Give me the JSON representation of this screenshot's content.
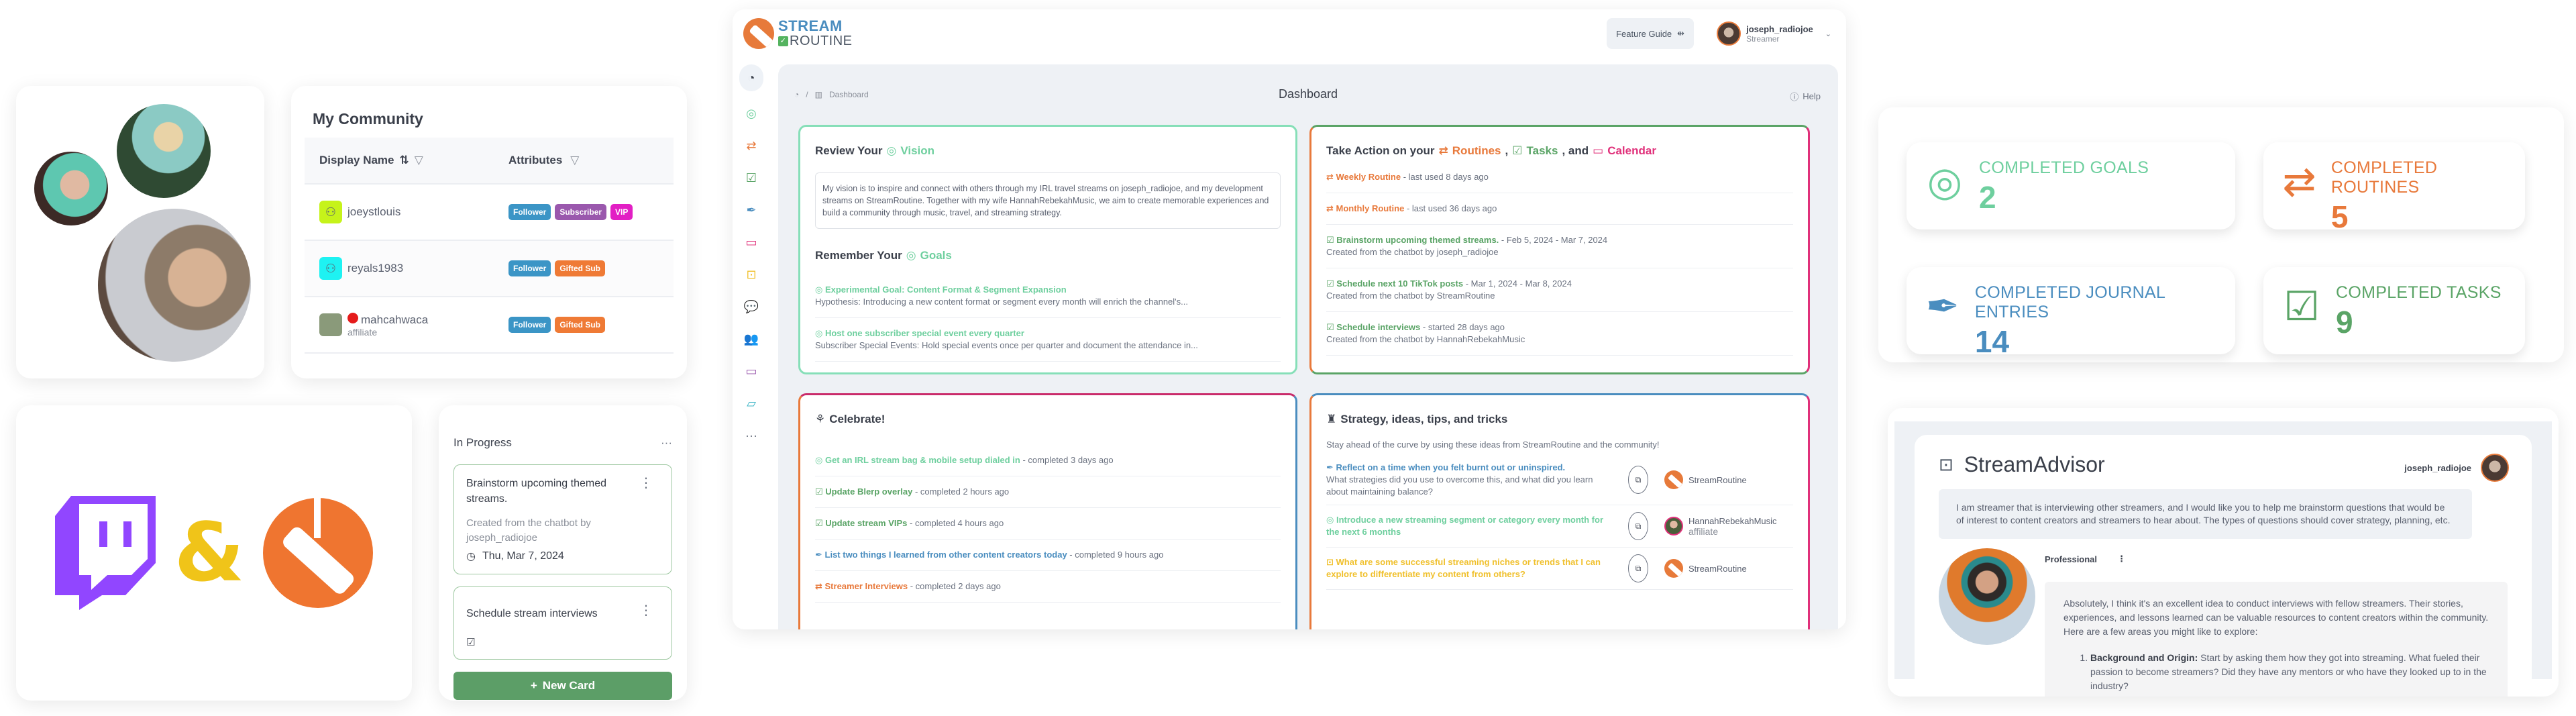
{
  "community": {
    "title": "My Community",
    "columns": [
      "Display Name",
      "Attributes"
    ],
    "rows": [
      {
        "name": "joeystlouis",
        "sub": "",
        "avatar_color": "#c6f31a",
        "badges": [
          {
            "label": "Follower",
            "color": "#3b95c6"
          },
          {
            "label": "Subscriber",
            "color": "#9a58ad"
          },
          {
            "label": "VIP",
            "color": "#e21fc4"
          }
        ]
      },
      {
        "name": "reyals1983",
        "sub": "",
        "avatar_color": "#1ef2f2",
        "badges": [
          {
            "label": "Follower",
            "color": "#3b95c6"
          },
          {
            "label": "Gifted Sub",
            "color": "#ef7a35"
          }
        ]
      },
      {
        "name": "mahcahwaca",
        "sub": "affiliate",
        "avatar_color": "#8a9a7a",
        "badges": [
          {
            "label": "Follower",
            "color": "#3b95c6"
          },
          {
            "label": "Gifted Sub",
            "color": "#ef7a35"
          }
        ]
      }
    ]
  },
  "logos": {
    "amp": "&"
  },
  "kanban": {
    "column_title": "In Progress",
    "cards": [
      {
        "title": "Brainstorm upcoming themed streams.",
        "desc": "Created from the chatbot by joseph_radiojoe",
        "date": "Thu, Mar 7, 2024"
      },
      {
        "title": "Schedule stream interviews",
        "desc": "",
        "date": ""
      }
    ],
    "new_card_label": "New Card"
  },
  "app": {
    "logo_line1": "STREAM",
    "logo_line2": "ROUTINE",
    "feature_guide": "Feature Guide",
    "user": {
      "name": "joseph_radiojoe",
      "role": "Streamer"
    },
    "breadcrumb": "Dashboard",
    "page_title": "Dashboard",
    "help": "Help",
    "sidebar_icons": [
      "dashboard-icon",
      "goals-icon",
      "routines-icon",
      "tasks-icon",
      "journal-icon",
      "calendar-icon",
      "advisor-icon",
      "qa-icon",
      "community-icon",
      "video-icon",
      "folder-icon",
      "more-icon"
    ]
  },
  "vision": {
    "review_prefix": "Review Your",
    "review_word": "Vision",
    "text": "My vision is to inspire and connect with others through my IRL travel streams on joseph_radiojoe, and my development streams on StreamRoutine. Together with my wife HannahRebekahMusic, we aim to create memorable experiences and build a community through music, travel, and streaming strategy.",
    "goals_prefix": "Remember Your",
    "goals_word": "Goals",
    "goals": [
      {
        "title": "Experimental Goal: Content Format & Segment Expansion",
        "desc": "Hypothesis: Introducing a new content format or segment every month will enrich the channel's..."
      },
      {
        "title": "Host one subscriber special event every quarter",
        "desc": "Subscriber Special Events: Hold special events once per quarter and document the attendance in..."
      }
    ]
  },
  "action": {
    "prefix": "Take Action on your",
    "routines": "Routines",
    "tasks": "Tasks",
    "and": ", and",
    "calendar": "Calendar",
    "items": [
      {
        "kind": "routine",
        "title": "Weekly Routine",
        "meta": " - last used 8 days ago",
        "sub": ""
      },
      {
        "kind": "routine",
        "title": "Monthly Routine",
        "meta": " - last used 36 days ago",
        "sub": ""
      },
      {
        "kind": "task",
        "title": "Brainstorm upcoming themed streams.",
        "meta": " - Feb 5, 2024 - Mar 7, 2024",
        "sub": "Created from the chatbot by joseph_radiojoe"
      },
      {
        "kind": "task",
        "title": "Schedule next 10 TikTok posts",
        "meta": " - Mar 1, 2024 - Mar 8, 2024",
        "sub": "Created from the chatbot by StreamRoutine"
      },
      {
        "kind": "task",
        "title": "Schedule interviews",
        "meta": " - started 28 days ago",
        "sub": "Created from the chatbot by HannahRebekahMusic"
      }
    ]
  },
  "celebrate": {
    "title": "Celebrate!",
    "items": [
      {
        "kind": "goal",
        "title": "Get an IRL stream bag & mobile setup dialed in",
        "meta": " - completed 3 days ago"
      },
      {
        "kind": "task",
        "title": "Update Blerp overlay",
        "meta": " - completed 2 hours ago"
      },
      {
        "kind": "task",
        "title": "Update stream VIPs",
        "meta": " - completed 4 hours ago"
      },
      {
        "kind": "journal",
        "title": "List two things I learned from other content creators today",
        "meta": " - completed 9 hours ago"
      },
      {
        "kind": "routine",
        "title": "Streamer Interviews",
        "meta": " - completed 2 days ago"
      }
    ]
  },
  "strategy": {
    "title": "Strategy, ideas, tips, and tricks",
    "subtitle": "Stay ahead of the curve by using these ideas from StreamRoutine and the community!",
    "tips": [
      {
        "kind": "journal",
        "title": "Reflect on a time when you felt burnt out or uninspired.",
        "desc": "What strategies did you use to overcome this, and what did you learn about maintaining balance?",
        "author": "StreamRoutine",
        "author_sub": ""
      },
      {
        "kind": "goal",
        "title": "Introduce a new streaming segment or category every month for the next 6 months",
        "desc": "",
        "author": "HannahRebekahMusic",
        "author_sub": "affiliate"
      },
      {
        "kind": "advisor",
        "title": "What are some successful streaming niches or trends that I can explore to differentiate my content from others?",
        "desc": "",
        "author": "StreamRoutine",
        "author_sub": ""
      }
    ]
  },
  "stats": [
    {
      "label": "COMPLETED GOALS",
      "value": "2",
      "color": "#6ecf9e",
      "icon": "goal-target-icon"
    },
    {
      "label": "COMPLETED ROUTINES",
      "value": "5",
      "color": "#e8793b",
      "icon": "routine-repeat-icon"
    },
    {
      "label": "COMPLETED JOURNAL ENTRIES",
      "value": "14",
      "color": "#4a8dbf",
      "icon": "journal-pen-icon"
    },
    {
      "label": "COMPLETED TASKS",
      "value": "9",
      "color": "#5aa466",
      "icon": "task-check-icon"
    }
  ],
  "advisor": {
    "title": "StreamAdvisor",
    "user": "joseph_radiojoe",
    "prompt": "I am streamer that is interviewing other streamers, and I would like you to help me brainstorm questions that would be of interest to content creators and streamers to hear about. The types of questions should cover strategy, planning, etc.",
    "persona": "Professional",
    "answer": "Absolutely, I think it's an excellent idea to conduct interviews with fellow streamers. Their stories, experiences, and lessons learned can be valuable resources to content creators within the community. Here are a few areas you might like to explore:",
    "list": [
      {
        "bold": "Background and Origin:",
        "text": " Start by asking them how they got into streaming. What fueled their passion to become streamers? Did they have any mentors or who have they looked up to in the industry?"
      }
    ]
  }
}
